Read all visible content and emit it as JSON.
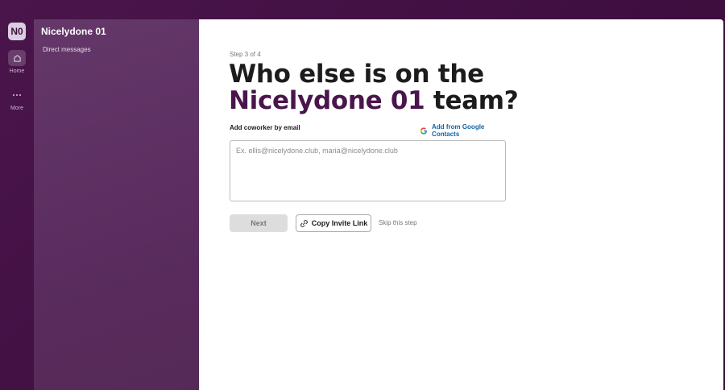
{
  "rail": {
    "workspace_initials": "N0",
    "home_label": "Home",
    "more_label": "More"
  },
  "sidebar": {
    "workspace_name": "Nicelydone 01",
    "items": [
      {
        "label": "Direct messages"
      }
    ]
  },
  "main": {
    "step": "Step 3 of 4",
    "title_part1": "Who else is on the",
    "title_workspace": "Nicelydone 01",
    "title_part2": "team?",
    "field_label": "Add coworker by email",
    "google_link": "Add from Google Contacts",
    "email_placeholder": "Ex. ellis@nicelydone.club, maria@nicelydone.club",
    "email_value": "",
    "next_label": "Next",
    "copy_link_label": "Copy Invite Link",
    "skip_label": "Skip this step"
  },
  "colors": {
    "aubergine": "#4a154b",
    "sidebar": "#5a2c5f",
    "link": "#1264a3",
    "button_disabled": "#dddddd"
  }
}
